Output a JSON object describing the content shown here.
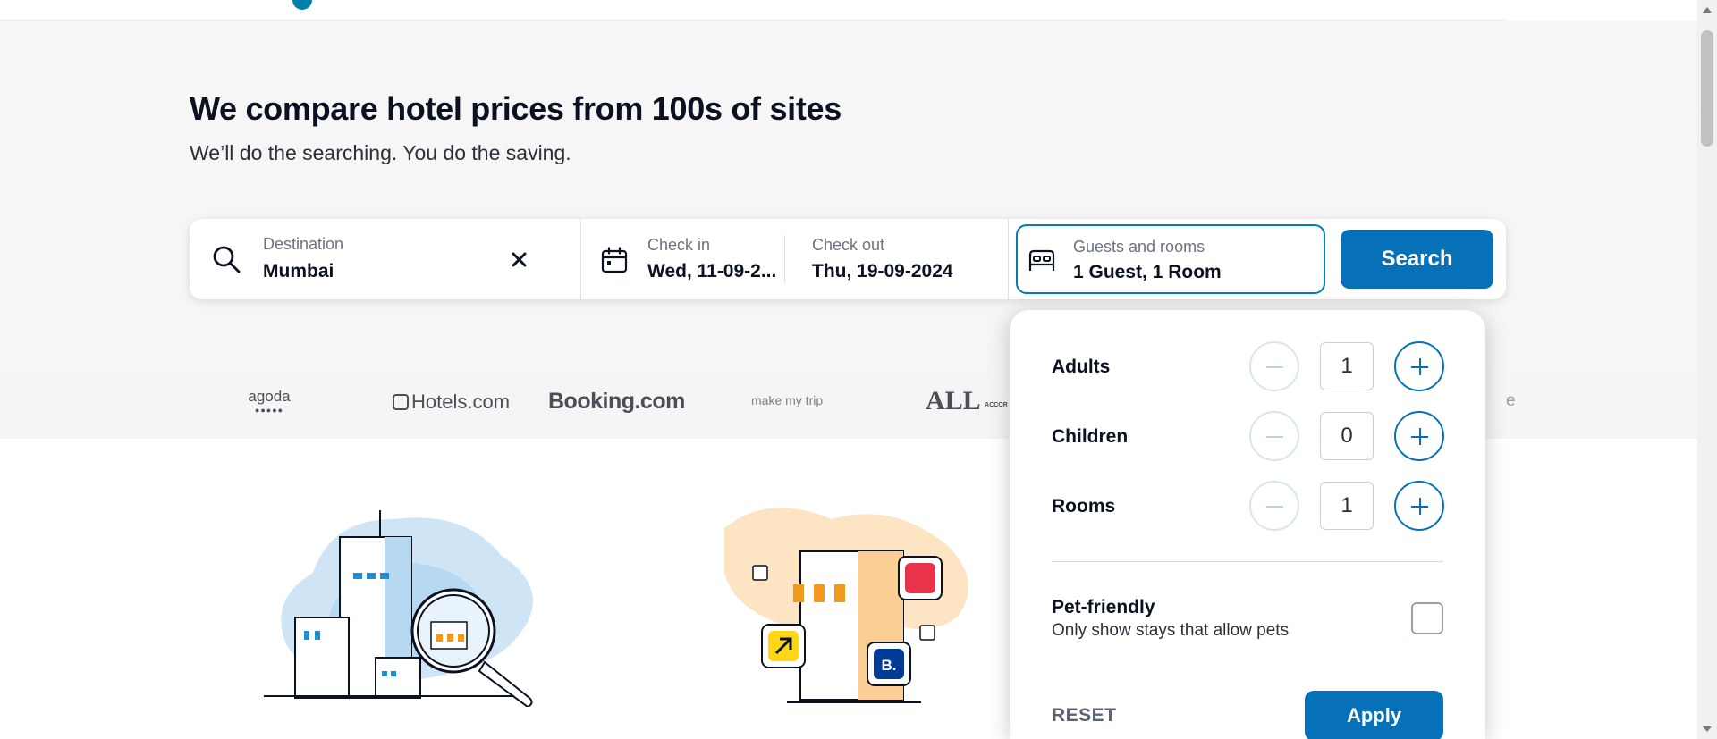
{
  "hero": {
    "title": "We compare hotel prices from 100s of sites",
    "subtitle": "We’ll do the searching. You do the saving."
  },
  "search": {
    "destination_label": "Destination",
    "destination_value": "Mumbai",
    "checkin_label": "Check in",
    "checkin_value": "Wed, 11-09-2...",
    "checkout_label": "Check out",
    "checkout_value": "Thu, 19-09-2024",
    "guests_label": "Guests and rooms",
    "guests_value": "1 Guest, 1 Room",
    "search_button": "Search",
    "icons": [
      "search-icon",
      "clear-icon",
      "calendar-icon",
      "bed-icon"
    ]
  },
  "partners": {
    "items": [
      "agoda",
      "Hotels.com",
      "Booking.com",
      "make my trip",
      "ALL Accor Live Limitless"
    ],
    "accor_subtext": "ACCOR LIVE LIMITLESS"
  },
  "guests_popup": {
    "rows": [
      {
        "label": "Adults",
        "value": "1"
      },
      {
        "label": "Children",
        "value": "0"
      },
      {
        "label": "Rooms",
        "value": "1"
      }
    ],
    "pet_title": "Pet-friendly",
    "pet_subtitle": "Only show stays that allow pets",
    "pet_checked": false,
    "reset_label": "RESET",
    "apply_label": "Apply"
  },
  "colors": {
    "brand_blue": "#0771b8",
    "focus_border": "#007fad",
    "text_dark": "#0a1121"
  }
}
